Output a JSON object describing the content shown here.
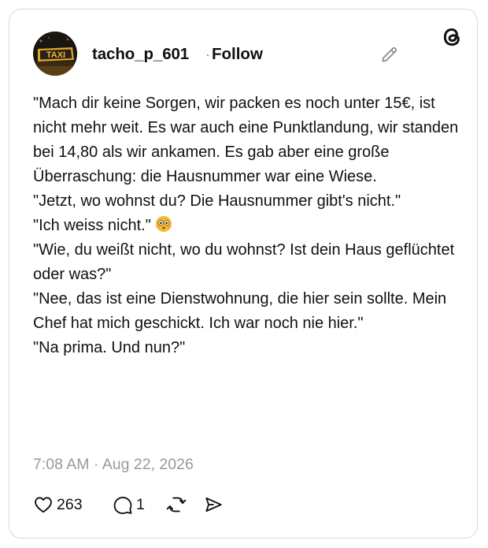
{
  "post": {
    "author": {
      "username": "tacho_p_601",
      "avatar_text": "TAXI"
    },
    "separator": "·",
    "follow_label": "Follow",
    "paragraphs": [
      "\"Mach dir keine Sorgen, wir packen es noch unter 15€, ist nicht mehr weit. Es war auch eine Punktlandung, wir standen bei 14,80 als wir ankamen. Es gab aber eine große Überraschung: die Hausnummer war eine Wiese.",
      "\"Jetzt, wo wohnst du? Die Hausnummer gibt's nicht.\"",
      "\"Ich weiss nicht.\"",
      "\"Wie, du weißt nicht, wo du wohnst? Ist dein Haus geflüchtet oder was?\"",
      "\"Nee, das ist eine Dienstwohnung, die hier sein sollte. Mein Chef hat mich geschickt. Ich war noch nie hier.\"",
      "\"Na prima. Und nun?\""
    ],
    "emoji_after_paragraph_3": "flushed-face-emoji",
    "timestamp": "7:08 AM · Aug 22, 2026",
    "likes": "263",
    "replies": "1"
  },
  "icons": {
    "edit": "pencil-icon",
    "logo": "threads-logo-icon",
    "like": "heart-icon",
    "reply": "speech-bubble-icon",
    "repost": "repost-icon",
    "share": "send-icon"
  },
  "colors": {
    "text": "#101010",
    "muted": "#9a9a9a",
    "border": "#d9d9d9",
    "emoji": "#f5b82e"
  }
}
